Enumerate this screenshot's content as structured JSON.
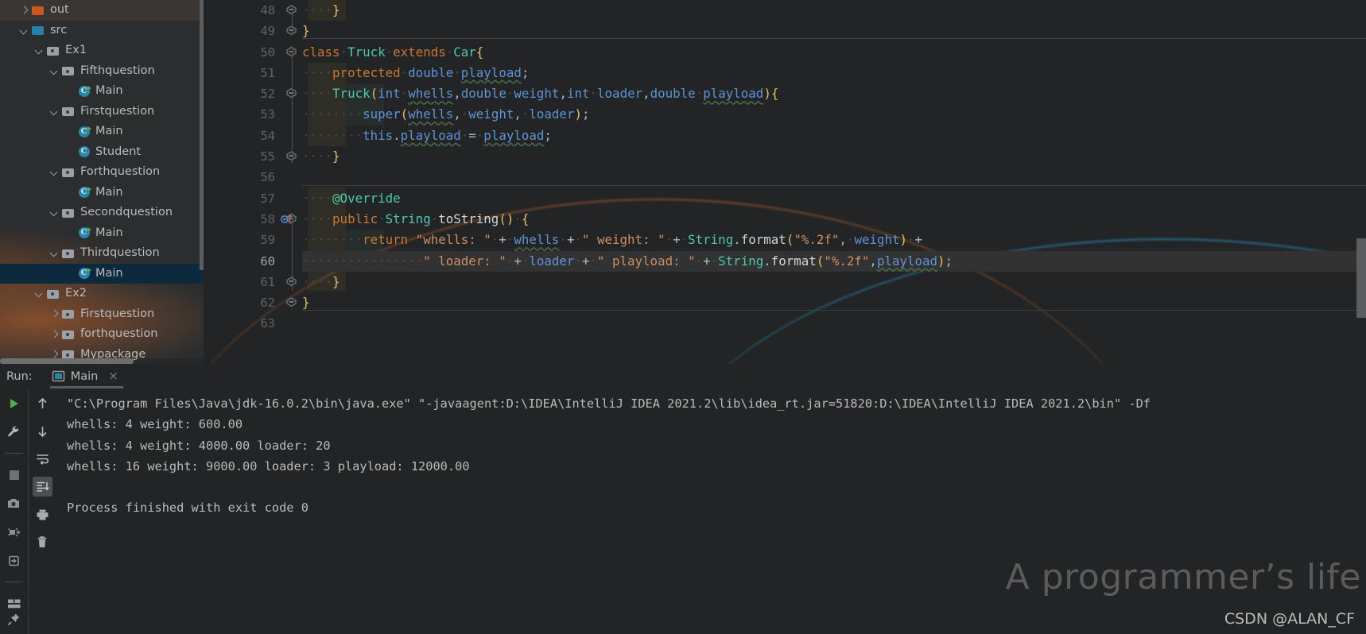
{
  "app": {
    "theme_bg": "#232425",
    "accent": "#4ec9b0",
    "selection_color": "#0d293e"
  },
  "project_tree": {
    "name": "Project",
    "items": [
      {
        "label": "out",
        "indent": 1,
        "twisty": "closed",
        "icon": "folder-orange",
        "state": "hover"
      },
      {
        "label": "src",
        "indent": 1,
        "twisty": "open",
        "icon": "folder-blue",
        "state": "normal"
      },
      {
        "label": "Ex1",
        "indent": 2,
        "twisty": "open",
        "icon": "folder-grey",
        "state": "normal"
      },
      {
        "label": "Fifthquestion",
        "indent": 3,
        "twisty": "open",
        "icon": "folder-grey",
        "state": "normal"
      },
      {
        "label": "Main",
        "indent": 4,
        "twisty": "none",
        "icon": "class-runnable",
        "state": "normal"
      },
      {
        "label": "Firstquestion",
        "indent": 3,
        "twisty": "open",
        "icon": "folder-grey",
        "state": "normal"
      },
      {
        "label": "Main",
        "indent": 4,
        "twisty": "none",
        "icon": "class-runnable",
        "state": "normal"
      },
      {
        "label": "Student",
        "indent": 4,
        "twisty": "none",
        "icon": "class",
        "state": "normal"
      },
      {
        "label": "Forthquestion",
        "indent": 3,
        "twisty": "open",
        "icon": "folder-grey",
        "state": "normal"
      },
      {
        "label": "Main",
        "indent": 4,
        "twisty": "none",
        "icon": "class-runnable",
        "state": "normal"
      },
      {
        "label": "Secondquestion",
        "indent": 3,
        "twisty": "open",
        "icon": "folder-grey",
        "state": "normal"
      },
      {
        "label": "Main",
        "indent": 4,
        "twisty": "none",
        "icon": "class-runnable",
        "state": "normal"
      },
      {
        "label": "Thirdquestion",
        "indent": 3,
        "twisty": "open",
        "icon": "folder-grey",
        "state": "normal"
      },
      {
        "label": "Main",
        "indent": 4,
        "twisty": "none",
        "icon": "class-runnable",
        "state": "selected"
      },
      {
        "label": "Ex2",
        "indent": 2,
        "twisty": "open",
        "icon": "folder-grey",
        "state": "normal"
      },
      {
        "label": "Firstquestion",
        "indent": 3,
        "twisty": "closed",
        "icon": "folder-grey",
        "state": "normal"
      },
      {
        "label": "forthquestion",
        "indent": 3,
        "twisty": "closed",
        "icon": "folder-grey",
        "state": "normal"
      },
      {
        "label": "Mypackage",
        "indent": 3,
        "twisty": "closed",
        "icon": "folder-grey",
        "state": "normal"
      }
    ]
  },
  "editor": {
    "first_line": 48,
    "current_line": 60,
    "lines": [
      {
        "n": 48,
        "text": "    }"
      },
      {
        "n": 49,
        "text": "}"
      },
      {
        "n": 50,
        "text": "class Truck extends Car{"
      },
      {
        "n": 51,
        "text": "    protected double playload;"
      },
      {
        "n": 52,
        "text": "    Truck(int whells,double weight,int loader,double playload){"
      },
      {
        "n": 53,
        "text": "        super(whells, weight, loader);"
      },
      {
        "n": 54,
        "text": "        this.playload = playload;"
      },
      {
        "n": 55,
        "text": "    }"
      },
      {
        "n": 56,
        "text": ""
      },
      {
        "n": 57,
        "text": "    @Override"
      },
      {
        "n": 58,
        "text": "    public String toString() {"
      },
      {
        "n": 59,
        "text": "        return \"whells: \" + whells + \" weight: \" + String.format(\"%.2f\", weight) +"
      },
      {
        "n": 60,
        "text": "                \" loader: \" + loader + \" playload: \" + String.format(\"%.2f\",playload);"
      },
      {
        "n": 61,
        "text": "    }"
      },
      {
        "n": 62,
        "text": "}"
      },
      {
        "n": 63,
        "text": ""
      }
    ],
    "gutter_icons": {
      "line58": "override-method-icon",
      "line60": "intention-bulb-icon"
    }
  },
  "run_panel": {
    "label": "Run:",
    "tab_name": "Main",
    "tab_icon": "run-configuration-icon",
    "close_label": "×",
    "toolbar_left": [
      {
        "name": "rerun-button",
        "icon": "play-triangle"
      },
      {
        "name": "edit-config-button",
        "icon": "wrench"
      },
      {
        "name": "stop-button",
        "icon": "square"
      },
      {
        "name": "screenshot-button",
        "icon": "camera"
      },
      {
        "name": "debug-dump-button",
        "icon": "thread-dump"
      },
      {
        "name": "export-button",
        "icon": "export-arrow"
      },
      {
        "name": "layout-button",
        "icon": "layout"
      },
      {
        "name": "pin-button",
        "icon": "pin"
      }
    ],
    "toolbar_right": [
      {
        "name": "up-button",
        "icon": "arrow-up"
      },
      {
        "name": "down-button",
        "icon": "arrow-down"
      },
      {
        "name": "soft-wrap-button",
        "icon": "soft-wrap"
      },
      {
        "name": "scroll-to-end-button",
        "icon": "scroll-end",
        "active": true
      },
      {
        "name": "print-button",
        "icon": "printer"
      },
      {
        "name": "clear-all-button",
        "icon": "trash"
      }
    ],
    "console_lines": [
      "\"C:\\Program Files\\Java\\jdk-16.0.2\\bin\\java.exe\" \"-javaagent:D:\\IDEA\\IntelliJ IDEA 2021.2\\lib\\idea_rt.jar=51820:D:\\IDEA\\IntelliJ IDEA 2021.2\\bin\" -Df",
      "whells: 4 weight: 600.00",
      "whells: 4 weight: 4000.00 loader: 20",
      "whells: 16 weight: 9000.00 loader: 3 playload: 12000.00",
      "",
      "Process finished with exit code 0"
    ]
  },
  "watermark": {
    "headline": "A programmer’s life",
    "credit": "CSDN @ALAN_CF"
  }
}
